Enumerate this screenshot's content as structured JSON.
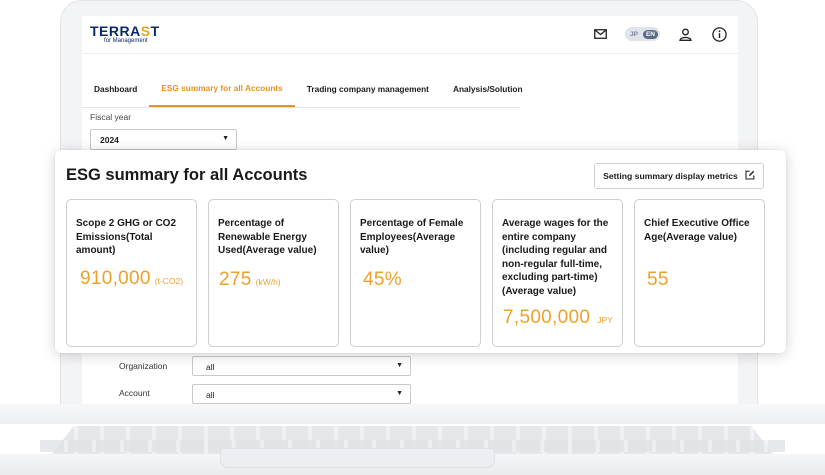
{
  "app": {
    "logo_main": "TERRAST",
    "logo_sub": "for Management",
    "lang_jp": "JP",
    "lang_en": "EN"
  },
  "tabs": [
    {
      "label": "Dashboard",
      "active": false
    },
    {
      "label": "ESG summary for all Accounts",
      "active": true
    },
    {
      "label": "Trading company management",
      "active": false
    },
    {
      "label": "Analysis/Solution",
      "active": false
    }
  ],
  "fiscal_year": {
    "label": "Fiscal year",
    "value": "2024"
  },
  "summary": {
    "title": "ESG summary for all Accounts",
    "settings_label": "Setting summary display metrics",
    "metrics": [
      {
        "title": "Scope 2 GHG or CO2 Emissions(Total amount)",
        "value": "910,000",
        "unit": "(t-CO2)"
      },
      {
        "title": "Percentage of Renewable Energy Used(Average value)",
        "value": "275",
        "unit": "(kW/h)"
      },
      {
        "title": "Percentage of Female Employees(Average value)",
        "value": "45%",
        "unit": ""
      },
      {
        "title": "Average wages for the entire company (including regular and non-regular full-time, excluding part-time) (Average value)",
        "value": "7,500,000",
        "unit": "JPY"
      },
      {
        "title": "Chief Executive Office Age(Average value)",
        "value": "55",
        "unit": ""
      }
    ]
  },
  "filters": {
    "organization": {
      "label": "Organization",
      "value": "all"
    },
    "account": {
      "label": "Account",
      "value": "all"
    }
  },
  "colors": {
    "accent": "#e8941c",
    "value": "#eea12a",
    "brand": "#0d2b6b"
  },
  "icons": [
    "mail-icon",
    "user-icon",
    "info-icon",
    "edit-icon",
    "chevron-down-icon"
  ]
}
